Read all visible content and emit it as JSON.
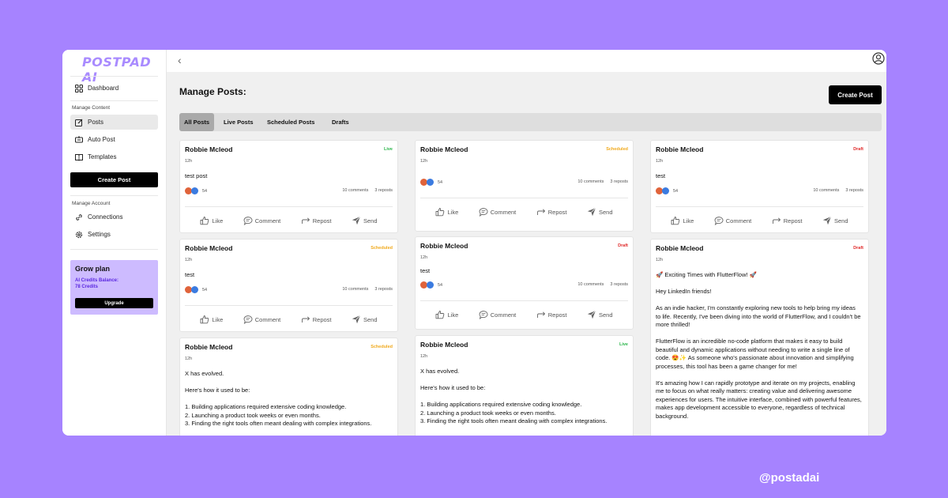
{
  "brand": "POSTPAD AI",
  "sidebar": {
    "dashboard": "Dashboard",
    "section_content": "Manage Content",
    "posts": "Posts",
    "auto_post": "Auto Post",
    "templates": "Templates",
    "create_post": "Create Post",
    "section_account": "Manage Account",
    "connections": "Connections",
    "settings": "Settings"
  },
  "plan": {
    "title": "Grow plan",
    "balance_label": "AI Credits Balance:",
    "balance_value": "78 Credits",
    "upgrade": "Upgrade"
  },
  "header": {
    "back": "‹",
    "title": "Manage Posts:",
    "create_post": "Create Post"
  },
  "tabs": [
    {
      "label": "All Posts",
      "active": true
    },
    {
      "label": "Live Posts",
      "active": false
    },
    {
      "label": "Scheduled Posts",
      "active": false
    },
    {
      "label": "Drafts",
      "active": false
    }
  ],
  "actions": {
    "like": "Like",
    "comment": "Comment",
    "repost": "Repost",
    "send": "Send"
  },
  "colors": {
    "live": "#2ab54a",
    "scheduled": "#f0a91c",
    "draft": "#e02a2a",
    "accent": "#a683ff"
  },
  "posts": [
    {
      "author": "Robbie Mcleod",
      "status": "Live",
      "time": "12h",
      "text": "test post",
      "reactions": "54",
      "comments": "10 comments",
      "reposts": "3 reposts"
    },
    {
      "author": "Robbie Mcleod",
      "status": "Scheduled",
      "time": "12h",
      "text": "",
      "reactions": "54",
      "comments": "10 comments",
      "reposts": "3 reposts"
    },
    {
      "author": "Robbie Mcleod",
      "status": "Draft",
      "time": "12h",
      "text": "test",
      "reactions": "54",
      "comments": "10 comments",
      "reposts": "3 reposts"
    },
    {
      "author": "Robbie Mcleod",
      "status": "Scheduled",
      "time": "12h",
      "text": "test",
      "reactions": "54",
      "comments": "10 comments",
      "reposts": "3 reposts"
    },
    {
      "author": "Robbie Mcleod",
      "status": "Draft",
      "time": "12h",
      "text": "test",
      "reactions": "54",
      "comments": "10 comments",
      "reposts": "3 reposts"
    },
    {
      "author": "Robbie Mcleod",
      "status": "Draft",
      "time": "12h",
      "paragraphs": [
        "🚀 Exciting Times with FlutterFlow! 🚀",
        "Hey LinkedIn friends!",
        "As an indie hacker, I'm constantly exploring new tools to help bring my ideas to life. Recently, I've been diving into the world of FlutterFlow, and I couldn't be more thrilled!",
        "FlutterFlow is an incredible no-code platform that makes it easy to build beautiful and dynamic applications without needing to write a single line of code. 😍✨ As someone who's passionate about innovation and simplifying processes, this tool has been a game changer for me!",
        "It's amazing how I can rapidly prototype and iterate on my projects, enabling me to focus on what really matters: creating value and delivering awesome experiences for users. The intuitive interface, combined with powerful features, makes app development accessible to everyone, regardless of technical background."
      ]
    },
    {
      "author": "Robbie Mcleod",
      "status": "Scheduled",
      "time": "12h",
      "paragraphs": [
        "X has evolved.",
        "Here's how it used to be:",
        "1. Building applications required extensive coding knowledge.\n2. Launching a product took weeks or even months.\n3. Finding the right tools often meant dealing with complex integrations."
      ]
    },
    {
      "author": "Robbie Mcleod",
      "status": "Live",
      "time": "12h",
      "paragraphs": [
        "X has evolved.",
        "Here's how it used to be:",
        "1. Building applications required extensive coding knowledge.\n2. Launching a product took weeks or even months.\n3. Finding the right tools often meant dealing with complex integrations."
      ]
    }
  ],
  "footer_handle": "@postadai"
}
